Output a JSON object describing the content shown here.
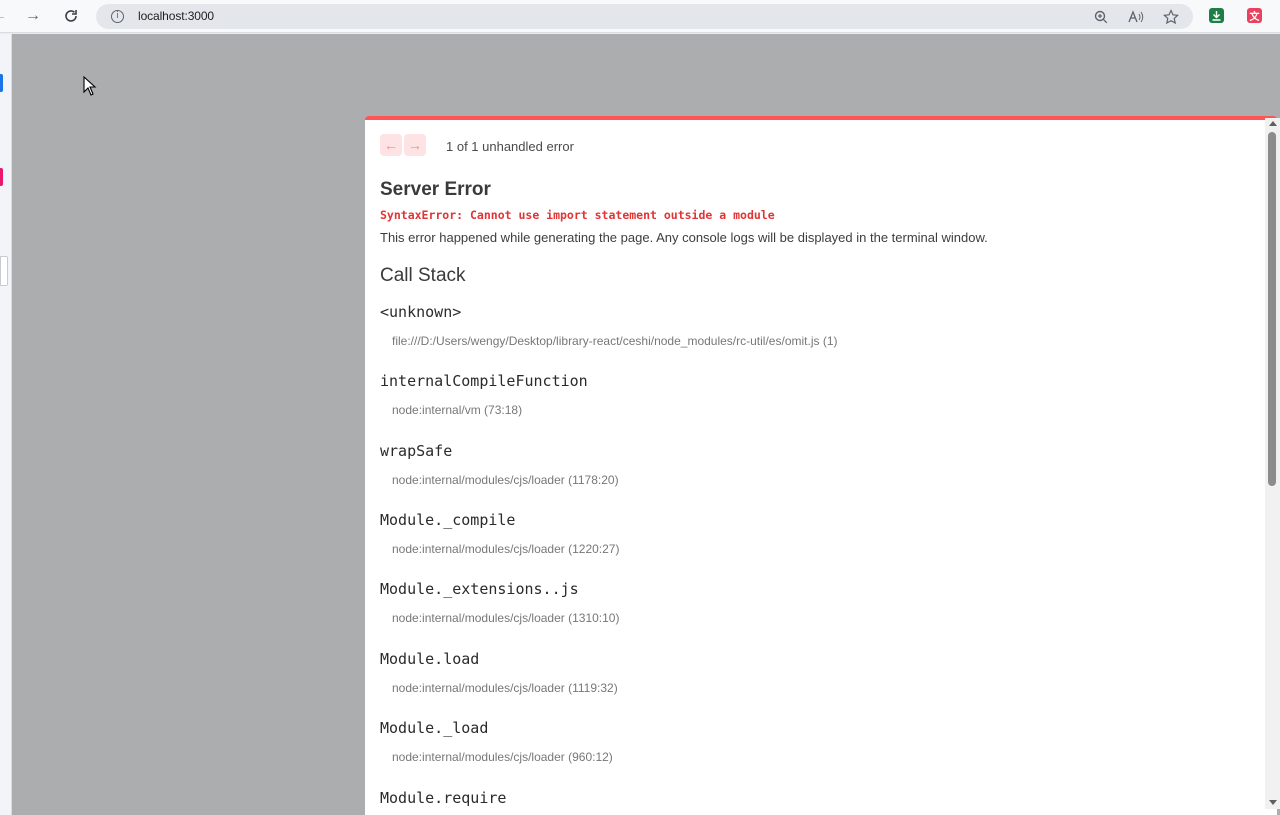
{
  "browser": {
    "url": "localhost:3000",
    "info_glyph": "i",
    "ext_translate_glyph": "文"
  },
  "overlay": {
    "prev_glyph": "←",
    "next_glyph": "→",
    "error_count": "1 of 1 unhandled error",
    "title": "Server Error",
    "error_message": "SyntaxError: Cannot use import statement outside a module",
    "description": "This error happened while generating the page. Any console logs will be displayed in the terminal window.",
    "call_stack_title": "Call Stack",
    "frames": [
      {
        "name": "<unknown>",
        "location": "file:///D:/Users/wengy/Desktop/library-react/ceshi/node_modules/rc-util/es/omit.js (1)"
      },
      {
        "name": "internalCompileFunction",
        "location": "node:internal/vm (73:18)"
      },
      {
        "name": "wrapSafe",
        "location": "node:internal/modules/cjs/loader (1178:20)"
      },
      {
        "name": "Module._compile",
        "location": "node:internal/modules/cjs/loader (1220:27)"
      },
      {
        "name": "Module._extensions..js",
        "location": "node:internal/modules/cjs/loader (1310:10)"
      },
      {
        "name": "Module.load",
        "location": "node:internal/modules/cjs/loader (1119:32)"
      },
      {
        "name": "Module._load",
        "location": "node:internal/modules/cjs/loader (960:12)"
      },
      {
        "name": "Module.require",
        "location": ""
      }
    ]
  },
  "colors": {
    "error_accent": "#ff5555",
    "error_text": "#e13434",
    "backdrop": "#abadae"
  }
}
